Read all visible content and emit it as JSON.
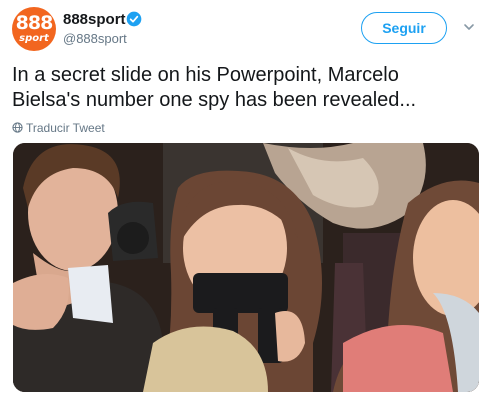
{
  "account": {
    "avatar_main": "888",
    "avatar_sub": "sport",
    "name": "888sport",
    "handle": "@888sport",
    "verified": true,
    "avatar_color": "#f2661f"
  },
  "follow_button": {
    "label": "Seguir"
  },
  "tweet": {
    "lines": [
      "In a secret slide on his Powerpoint, Marcelo",
      "Bielsa's number one spy has been revealed..."
    ]
  },
  "translate": {
    "label": "Traducir Tweet",
    "icon": "globe-icon"
  },
  "media": {
    "type": "photo"
  },
  "colors": {
    "accent": "#1da1f2",
    "muted": "#657786",
    "text": "#14171a"
  }
}
